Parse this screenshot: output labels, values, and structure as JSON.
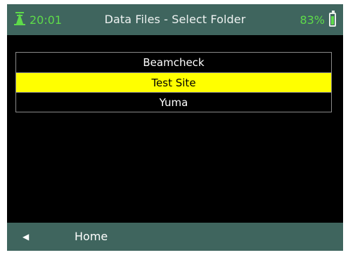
{
  "status": {
    "time": "20:01",
    "title": "Data Files - Select Folder",
    "battery_percent": "83%",
    "battery_level": 0.83,
    "signal_icon": "antenna-icon"
  },
  "folders": [
    {
      "label": "Beamcheck",
      "selected": false
    },
    {
      "label": "Test Site",
      "selected": true
    },
    {
      "label": "Yuma",
      "selected": false
    }
  ],
  "bottom": {
    "back_icon": "left-arrow-icon",
    "home_label": "Home"
  },
  "colors": {
    "bar": "#3f655e",
    "accent": "#5edb4a",
    "selection": "#ffff00"
  }
}
